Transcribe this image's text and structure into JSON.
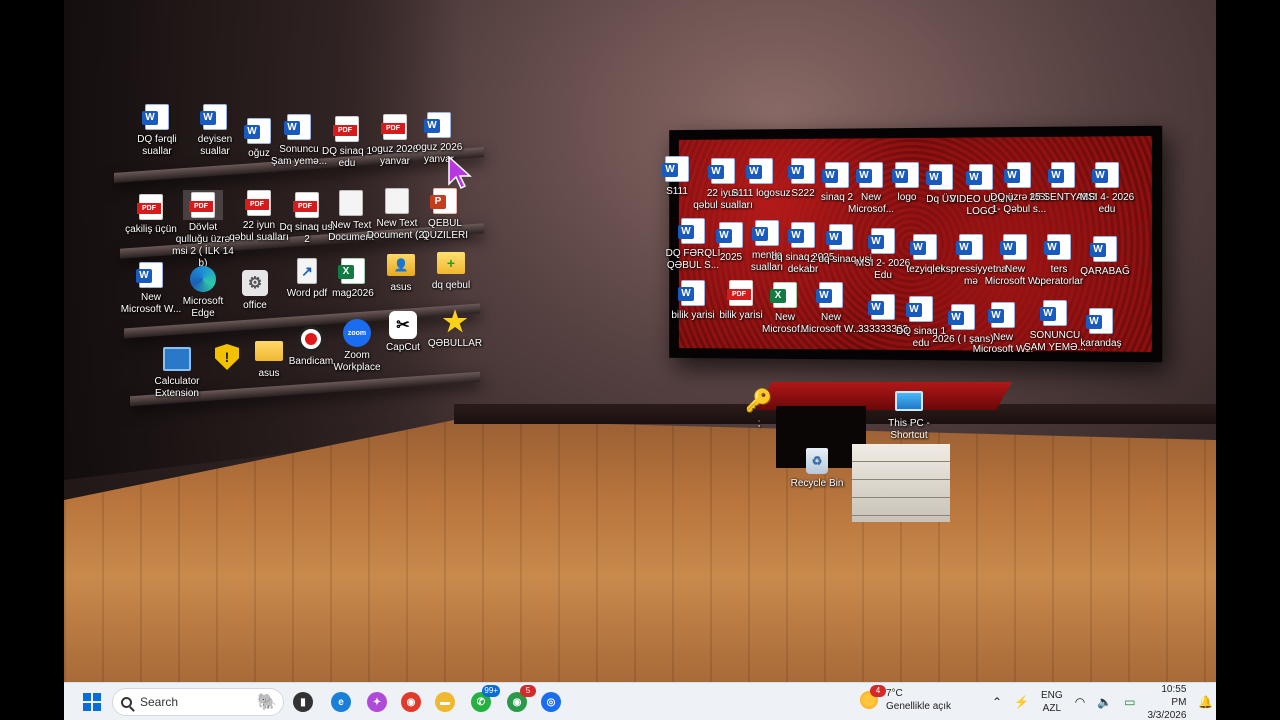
{
  "desktop": {
    "shelf_row1": [
      {
        "label": "DQ fərqli\nsuallar",
        "type": "word"
      },
      {
        "label": "deyisen\nsuallar",
        "type": "word"
      },
      {
        "label": "oğuz",
        "type": "word"
      },
      {
        "label": "Sonuncu\nŞam yemə...",
        "type": "word"
      },
      {
        "label": "DQ sinaq 1\nedu",
        "type": "pdf"
      },
      {
        "label": "oguz 2026\nyanvar",
        "type": "pdf"
      },
      {
        "label": "oguz 2026\nyanvar",
        "type": "word"
      }
    ],
    "shelf_row2": [
      {
        "label": "çakiliş üçün",
        "type": "pdf"
      },
      {
        "label": "Dövlət\nqulluğu üzrə\nmsi 2 ( İLK 14\nb)",
        "type": "pdf"
      },
      {
        "label": "22 iyun\nqəbul sualları",
        "type": "pdf"
      },
      {
        "label": "Dq sinaq usi\n2",
        "type": "pdf"
      },
      {
        "label": "New Text\nDocument",
        "type": "txt"
      },
      {
        "label": "New Text\nDocument (2)",
        "type": "txt"
      },
      {
        "label": "QEBUL\nQUZILERI",
        "type": "ppt"
      }
    ],
    "shelf_row3": [
      {
        "label": "New\nMicrosoft W...",
        "type": "word"
      },
      {
        "label": "Microsoft\nEdge",
        "type": "edge"
      },
      {
        "label": "office",
        "type": "gear"
      },
      {
        "label": "Word pdf",
        "type": "shortcut-pdf"
      },
      {
        "label": "mag2026",
        "type": "excel"
      },
      {
        "label": "asus",
        "type": "user-folder"
      },
      {
        "label": "dq qebul",
        "type": "dq-folder"
      }
    ],
    "shelf_row4": [
      {
        "label": "Calculator Extension",
        "type": "chart"
      },
      {
        "label": "",
        "type": "shield"
      },
      {
        "label": "asus",
        "type": "folder"
      },
      {
        "label": "Bandicam",
        "type": "bandicam"
      },
      {
        "label": "Zoom\nWorkplace",
        "type": "zoom",
        "glyph_text": "zoom"
      },
      {
        "label": "CapCut",
        "type": "capcut"
      },
      {
        "label": "QƏBULLAR",
        "type": "star"
      }
    ],
    "frame_row1": [
      {
        "label": "S111",
        "type": "word"
      },
      {
        "label": "22 iyun\nqəbul sualları",
        "type": "word"
      },
      {
        "label": "S111 logosuz",
        "type": "word"
      },
      {
        "label": "S222",
        "type": "word"
      },
      {
        "label": "sinaq 2",
        "type": "word"
      },
      {
        "label": "New\nMicrosof...",
        "type": "word"
      },
      {
        "label": "logo",
        "type": "word"
      },
      {
        "label": "Dq ÜS",
        "type": "word"
      },
      {
        "label": "VIDEO UCUN\nLOGO",
        "type": "word"
      },
      {
        "label": "DQ üzrə MSI\n1- Qəbul s...",
        "type": "word"
      },
      {
        "label": "25 SENTYABR",
        "type": "word"
      },
      {
        "label": "MSI 4- 2026\nedu",
        "type": "word"
      }
    ],
    "frame_row2": [
      {
        "label": "DQ FƏRQLİ\nQƏBUL S...",
        "type": "word"
      },
      {
        "label": "2025",
        "type": "word"
      },
      {
        "label": "mentiq\nsualları",
        "type": "word"
      },
      {
        "label": "dq sinaq 2025\ndekabr",
        "type": "word"
      },
      {
        "label": "2 dq sinaq usi",
        "type": "word"
      },
      {
        "label": "MSI 2- 2026\nEdu",
        "type": "word"
      },
      {
        "label": "tezyiqler",
        "type": "word"
      },
      {
        "label": "ekspressiyyetnamə",
        "type": "word"
      },
      {
        "label": "New\nMicrosoft W...",
        "type": "word"
      },
      {
        "label": "ters\noperatorlar",
        "type": "word"
      },
      {
        "label": "QARABAĞ",
        "type": "word"
      }
    ],
    "frame_row3": [
      {
        "label": "bilik yarisi",
        "type": "word"
      },
      {
        "label": "bilik yarisi",
        "type": "pdf"
      },
      {
        "label": "New\nMicrosof...",
        "type": "excel"
      },
      {
        "label": "New\nMicrosoft W...",
        "type": "word"
      },
      {
        "label": "333333333",
        "type": "word"
      },
      {
        "label": "DQ sinaq 1\nedu",
        "type": "word"
      },
      {
        "label": "2026 ( I şans)",
        "type": "word"
      },
      {
        "label": "New\nMicrosoft W...",
        "type": "word"
      },
      {
        "label": "SONUNCU\nŞAM YEMƏ...",
        "type": "word"
      },
      {
        "label": "karandaş",
        "type": "word"
      }
    ],
    "floor_icons": [
      {
        "label": ";",
        "type": "key"
      },
      {
        "label": "This PC -\nShortcut",
        "type": "pc"
      },
      {
        "label": "Recycle Bin",
        "type": "recycle"
      }
    ]
  },
  "taskbar": {
    "search_placeholder": "Search",
    "apps": [
      {
        "name": "task-view",
        "color": "#333333",
        "glyph": "▮"
      },
      {
        "name": "edge",
        "color": "#1a7fd8",
        "glyph": "e"
      },
      {
        "name": "copilot",
        "color": "#b04ad8",
        "glyph": "✦"
      },
      {
        "name": "chrome",
        "color": "#e23a2a",
        "glyph": "◉"
      },
      {
        "name": "file-explorer",
        "color": "#f0b830",
        "glyph": "▬"
      },
      {
        "name": "whatsapp",
        "color": "#25b040",
        "glyph": "✆",
        "badge": "99+"
      },
      {
        "name": "chrome-profile",
        "color": "#2a9a48",
        "glyph": "◉",
        "badge": "5",
        "badge_red": true
      },
      {
        "name": "zoom",
        "color": "#1a6cf0",
        "glyph": "◎"
      }
    ],
    "weather": {
      "temp": "7°C",
      "desc": "Genellikle açık",
      "alerts": "4"
    },
    "tray": {
      "lang_top": "ENG",
      "lang_bottom": "AZL",
      "time": "10:55 PM",
      "date": "3/3/2026"
    }
  }
}
